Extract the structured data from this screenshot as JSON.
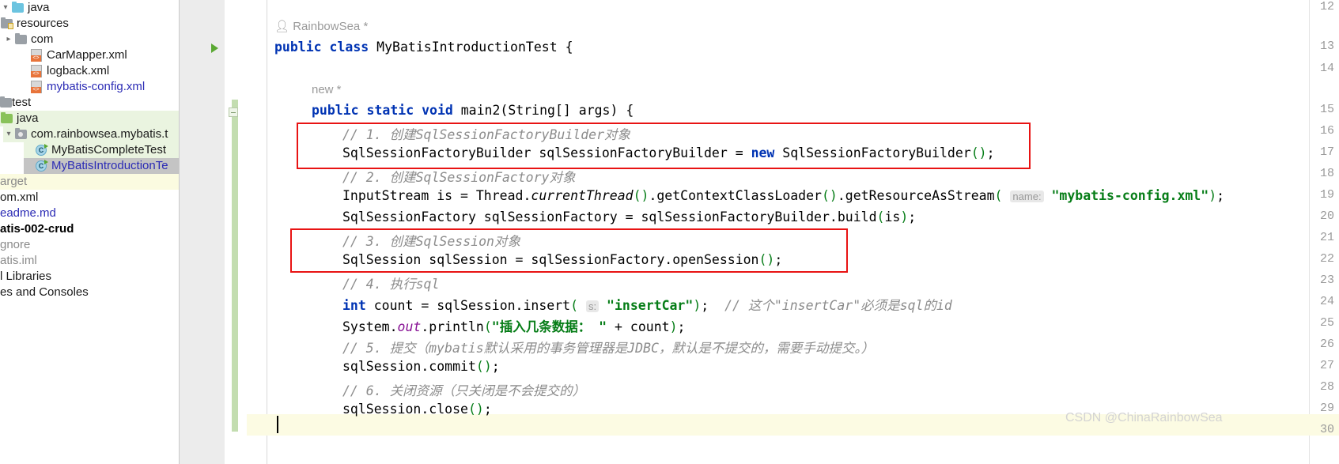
{
  "sidebar": {
    "items": [
      {
        "label": "java",
        "kind": "folder-blue",
        "indent": 1,
        "arrow": "v",
        "row_bg": "none",
        "label_color": "default"
      },
      {
        "label": "resources",
        "kind": "folder-resources",
        "indent": 0,
        "arrow": "v",
        "row_bg": "none",
        "label_color": "default"
      },
      {
        "label": "com",
        "kind": "folder-gray",
        "indent": 1,
        "arrow": ">",
        "row_bg": "none",
        "label_color": "default"
      },
      {
        "label": "CarMapper.xml",
        "kind": "xml",
        "indent": 2,
        "arrow": "",
        "row_bg": "none",
        "label_color": "default"
      },
      {
        "label": "logback.xml",
        "kind": "xml",
        "indent": 2,
        "arrow": "",
        "row_bg": "none",
        "label_color": "default"
      },
      {
        "label": "mybatis-config.xml",
        "kind": "xml",
        "indent": 2,
        "arrow": "",
        "row_bg": "none",
        "label_color": "blue"
      },
      {
        "label": "test",
        "kind": "folder-gray-clipped",
        "indent": -1,
        "arrow": "",
        "row_bg": "none",
        "label_color": "default"
      },
      {
        "label": "java",
        "kind": "folder-green",
        "indent": 0,
        "arrow": "v",
        "row_bg": "green",
        "label_color": "default"
      },
      {
        "label": "com.rainbowsea.mybatis.t",
        "kind": "folder-package",
        "indent": 1,
        "arrow": "v",
        "row_bg": "green",
        "label_color": "default"
      },
      {
        "label": "MyBatisCompleteTest",
        "kind": "class",
        "indent": 2,
        "arrow": "",
        "row_bg": "green",
        "label_color": "default"
      },
      {
        "label": "MyBatisIntroductionTe",
        "kind": "class",
        "indent": 2,
        "arrow": "",
        "row_bg": "selected",
        "label_color": "blue"
      },
      {
        "label": "arget",
        "kind": "none",
        "indent": -2,
        "arrow": "",
        "row_bg": "yellow",
        "label_color": "gray"
      },
      {
        "label": "om.xml",
        "kind": "none",
        "indent": -2,
        "arrow": "",
        "row_bg": "none",
        "label_color": "default"
      },
      {
        "label": "eadme.md",
        "kind": "none",
        "indent": -2,
        "arrow": "",
        "row_bg": "none",
        "label_color": "blue"
      },
      {
        "label": "atis-002-crud",
        "kind": "none",
        "indent": -2,
        "arrow": "",
        "row_bg": "none",
        "label_color": "bold"
      },
      {
        "label": "gnore",
        "kind": "none",
        "indent": -2,
        "arrow": "",
        "row_bg": "none",
        "label_color": "gray"
      },
      {
        "label": "atis.iml",
        "kind": "none",
        "indent": -2,
        "arrow": "",
        "row_bg": "none",
        "label_color": "gray"
      },
      {
        "label": "l Libraries",
        "kind": "none",
        "indent": -2,
        "arrow": "",
        "row_bg": "none",
        "label_color": "default"
      },
      {
        "label": "es and Consoles",
        "kind": "none",
        "indent": -2,
        "arrow": "",
        "row_bg": "none",
        "label_color": "default"
      }
    ]
  },
  "editor": {
    "line_numbers": [
      "12",
      "13",
      "14",
      "15",
      "16",
      "17",
      "18",
      "19",
      "20",
      "21",
      "22",
      "23",
      "24",
      "25",
      "26",
      "27",
      "28",
      "29",
      "30"
    ],
    "inlay_hints": {
      "author": "RainbowSea *",
      "new_hint": "new *"
    },
    "code_lines": [
      {
        "n": "13",
        "text": "public class MyBatisIntroductionTest {"
      },
      {
        "n": "15",
        "text": "public static void main2(String[] args) {"
      },
      {
        "n": "16",
        "text": "// 1. 创建SqlSessionFactoryBuilder对象"
      },
      {
        "n": "17",
        "text": "SqlSessionFactoryBuilder sqlSessionFactoryBuilder = new SqlSessionFactoryBuilder();"
      },
      {
        "n": "18",
        "text": "// 2. 创建SqlSessionFactory对象"
      },
      {
        "n": "19",
        "text": "InputStream is = Thread.currentThread().getContextClassLoader().getResourceAsStream( name: \"mybatis-config.xml\");"
      },
      {
        "n": "20",
        "text": "SqlSessionFactory sqlSessionFactory = sqlSessionFactoryBuilder.build(is);"
      },
      {
        "n": "21",
        "text": "// 3. 创建SqlSession对象"
      },
      {
        "n": "22",
        "text": "SqlSession sqlSession = sqlSessionFactory.openSession();"
      },
      {
        "n": "23",
        "text": "// 4. 执行sql"
      },
      {
        "n": "24",
        "text": "int count = sqlSession.insert( s: \"insertCar\"); // 这个\"insertCar\"必须是sql的id"
      },
      {
        "n": "25",
        "text": "System.out.println(\"插入几条数据： \" + count);"
      },
      {
        "n": "26",
        "text": "// 5. 提交（mybatis默认采用的事务管理器是JDBC，默认是不提交的，需要手动提交。）"
      },
      {
        "n": "27",
        "text": "sqlSession.commit();"
      },
      {
        "n": "28",
        "text": "// 6. 关闭资源（只关闭是不会提交的）"
      },
      {
        "n": "29",
        "text": "sqlSession.close();"
      }
    ],
    "param_hints": {
      "name": "name:",
      "s": "s:"
    },
    "annotations": {
      "box_color": "#e81313",
      "box_count": 2
    }
  },
  "watermark": {
    "text": "CSDN @ChinaRainbowSea"
  }
}
